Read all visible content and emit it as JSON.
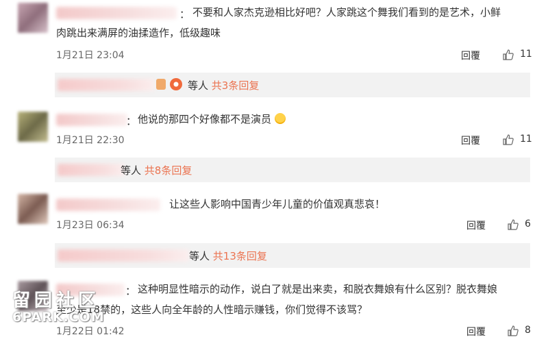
{
  "comments": [
    {
      "text_line1": "不要和人家杰克逊相比好吧？人家跳这个舞我们看到的是艺术，小鲜",
      "text_line2": "肉跳出来满屏的油揉造作，低级趣味",
      "time": "1月21日 23:04",
      "reply_label": "回覆",
      "likes": "11",
      "sub_replies": {
        "prefix": "等人",
        "count_label": "共3条回复"
      }
    },
    {
      "text_line1": "他说的那四个好像都不是演员",
      "time": "1月21日 22:30",
      "reply_label": "回覆",
      "likes": "11",
      "sub_replies": {
        "prefix": "等人",
        "count_label": "共8条回复"
      }
    },
    {
      "text_line1": "让这些人影响中国青少年儿童的价值观真悲哀！",
      "time": "1月23日 06:34",
      "reply_label": "回覆",
      "likes": "6",
      "sub_replies": {
        "prefix": "等人",
        "count_label": "共13条回复"
      }
    },
    {
      "text_line1": "这种明显性暗示的动作，说白了就是出来卖，和脱衣舞娘有什么区别？脱衣舞娘",
      "text_line2": "至少是18禁的，这些人向全年龄的人性暗示赚钱，你们觉得不该骂？",
      "time": "1月22日 01:42",
      "reply_label": "回覆",
      "likes": "8"
    }
  ],
  "colon": "：",
  "watermark": {
    "line1": "留园社区",
    "line2": "6PARK.COM"
  },
  "colors": {
    "accent": "#eb7350",
    "subbar": "#f2f2f2"
  },
  "icons": {
    "thumb": "thumbs-up-icon",
    "emoji": "crying-laughing-emoji-icon"
  }
}
